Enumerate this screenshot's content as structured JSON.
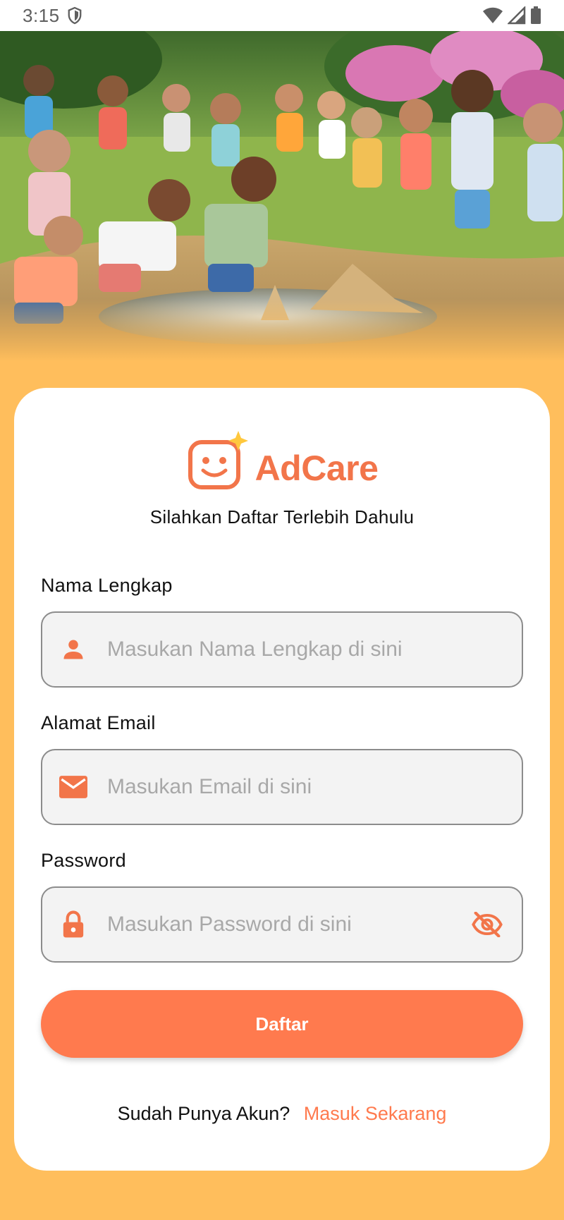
{
  "status_bar": {
    "time": "3:15",
    "icons": [
      "shield-icon",
      "wifi-icon",
      "signal-icon",
      "battery-icon"
    ]
  },
  "hero": {
    "image_alt_icon": "children-playing-image"
  },
  "brand": {
    "name": "AdCare",
    "accent_color": "#F2754A",
    "star_color": "#FFC83D"
  },
  "subtitle": "Silahkan Daftar Terlebih Dahulu",
  "form": {
    "full_name": {
      "label": "Nama Lengkap",
      "placeholder": "Masukan Nama Lengkap di sini",
      "value": "",
      "icon": "person-icon"
    },
    "email": {
      "label": "Alamat Email",
      "placeholder": "Masukan Email di sini",
      "value": "",
      "icon": "mail-icon"
    },
    "password": {
      "label": "Password",
      "placeholder": "Masukan Password di sini",
      "value": "",
      "icon": "lock-icon",
      "toggle_icon": "eye-off-icon"
    },
    "submit_label": "Daftar"
  },
  "footer": {
    "question": "Sudah Punya Akun?",
    "link_label": "Masuk Sekarang"
  },
  "colors": {
    "background": "#FFBE5C",
    "primary": "#FF7A4E",
    "field_bg": "#F3F3F3",
    "field_border": "#8C8C8C"
  }
}
